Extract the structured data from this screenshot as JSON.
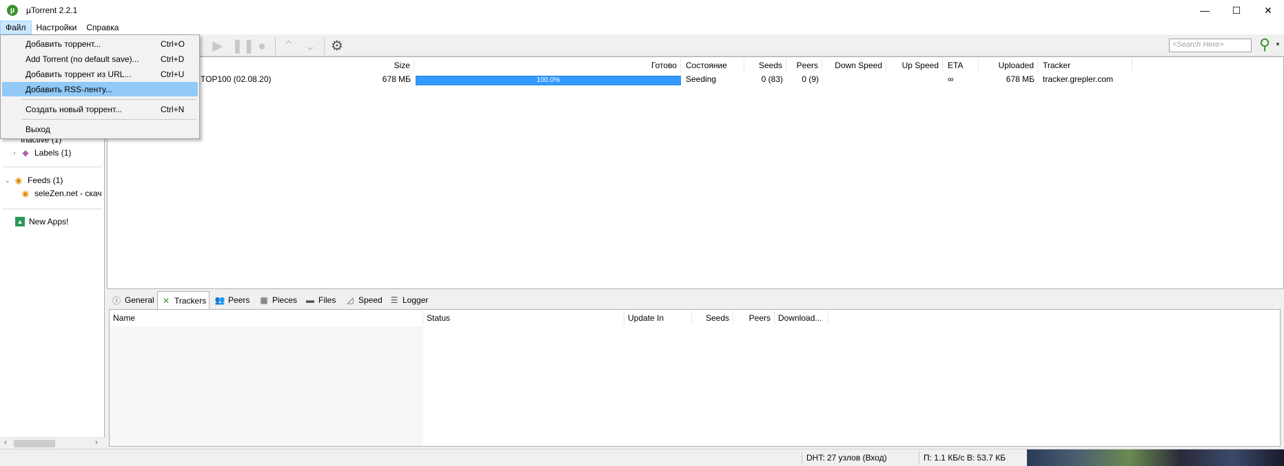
{
  "window": {
    "title": "µTorrent 2.2.1",
    "logo": "µ",
    "controls": [
      "—",
      "☐",
      "✕"
    ]
  },
  "menubar": {
    "items": [
      "Файл",
      "Настройки",
      "Справка"
    ]
  },
  "file_menu": {
    "items": [
      {
        "label": "Добавить торрент...",
        "shortcut": "Ctrl+O"
      },
      {
        "label": "Add Torrent (no default save)...",
        "shortcut": "Ctrl+D"
      },
      {
        "label": "Добавить торрент из URL...",
        "shortcut": "Ctrl+U"
      },
      {
        "label": "Добавить RSS-ленту...",
        "shortcut": ""
      },
      {
        "label": "Создать новый торрент...",
        "shortcut": "Ctrl+N"
      },
      {
        "label": "Выход",
        "shortcut": ""
      }
    ]
  },
  "toolbar": {
    "search_placeholder": "<Search Here>"
  },
  "sidebar": {
    "inactive": "Inactive (1)",
    "labels": "Labels (1)",
    "feeds": "Feeds (1)",
    "feed_item": "seleZen.net - скач",
    "new_apps": "New Apps!"
  },
  "torrent_list": {
    "columns": {
      "size": "Size",
      "done": "Готово",
      "status": "Состояние",
      "seeds": "Seeds",
      "peers": "Peers",
      "down_speed": "Down Speed",
      "up_speed": "Up Speed",
      "eta": "ETA",
      "uploaded": "Uploaded",
      "tracker": "Tracker"
    },
    "row": {
      "name": "TOP100 (02.08.20)",
      "size": "678 МБ",
      "done": "100.0%",
      "done_fraction": 1.0,
      "status": "Seeding",
      "seeds": "0 (83)",
      "peers": "0 (9)",
      "eta": "∞",
      "uploaded": "678 МБ",
      "tracker": "tracker.grepler.com"
    }
  },
  "detail_tabs": [
    "General",
    "Trackers",
    "Peers",
    "Pieces",
    "Files",
    "Speed",
    "Logger"
  ],
  "trackers_panel": {
    "columns": {
      "name": "Name",
      "status": "Status",
      "update_in": "Update In",
      "seeds": "Seeds",
      "peers": "Peers",
      "downloaded": "Download..."
    }
  },
  "statusbar": {
    "dht": "DHT: 27 узлов  (Вход)",
    "speed": "П: 1.1 КБ/с В: 53.7 КБ"
  },
  "colors": {
    "accent": "#3399ff",
    "brand": "#3b8f2f",
    "menu_hover": "#91c9f7"
  }
}
